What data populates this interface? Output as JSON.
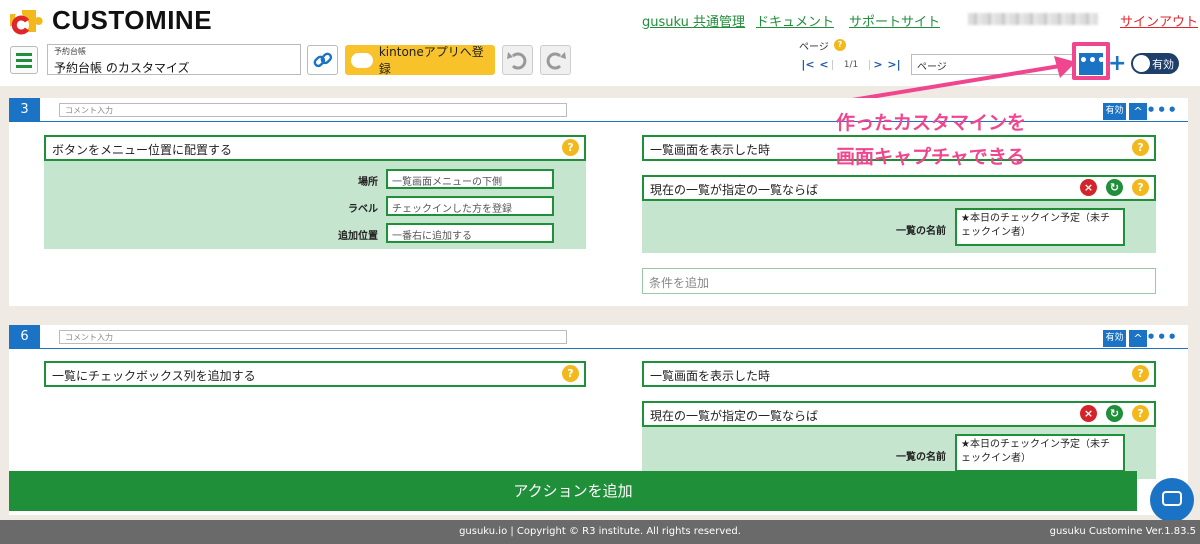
{
  "header": {
    "brand": "CUSTOMINE",
    "links": [
      "gusuku 共通管理",
      "ドキュメント",
      "サポートサイト"
    ],
    "signout": "サインアウト"
  },
  "toolbar": {
    "app_small": "予約台帳",
    "app_title": "予約台帳 のカスタマイズ",
    "kintone_button": "kintoneアプリへ登録",
    "page_label": "ページ",
    "page_num": "1/1",
    "page_select": "ページ",
    "more": "•••",
    "plus": "+",
    "toggle": "有効"
  },
  "annotation": {
    "line1": "作ったカスタマインを",
    "line2": "画面キャプチャできる"
  },
  "panel3": {
    "number": "3",
    "comment_placeholder": "コメント入力",
    "valid": "有効",
    "action": "ボタンをメニュー位置に配置する",
    "fields": [
      {
        "label": "場所",
        "value": "一覧画面メニューの下側"
      },
      {
        "label": "ラベル",
        "value": "チェックインした方を登録"
      },
      {
        "label": "追加位置",
        "value": "一番右に追加する"
      }
    ],
    "trigger": "一覧画面を表示した時",
    "condition": "現在の一覧が指定の一覧ならば",
    "cond_label": "一覧の名前",
    "cond_value": "★本日のチェックイン予定（未チェックイン者）",
    "add_condition": "条件を追加"
  },
  "panel6": {
    "number": "6",
    "comment_placeholder": "コメント入力",
    "valid": "有効",
    "action": "一覧にチェックボックス列を追加する",
    "trigger": "一覧画面を表示した時",
    "condition": "現在の一覧が指定の一覧ならば",
    "cond_label": "一覧の名前",
    "cond_value": "★本日のチェックイン予定（未チェックイン者）"
  },
  "add_action": "アクションを追加",
  "footer": {
    "copyright": "gusuku.io | Copyright © R3 institute. All rights reserved.",
    "version": "gusuku Customine Ver.1.83.5"
  },
  "icons": [
    "customine-logo-icon",
    "menu-icon",
    "link-icon",
    "cloud-icon",
    "undo-icon",
    "redo-icon",
    "help-icon",
    "remove-icon",
    "switch-icon",
    "chat-icon"
  ]
}
